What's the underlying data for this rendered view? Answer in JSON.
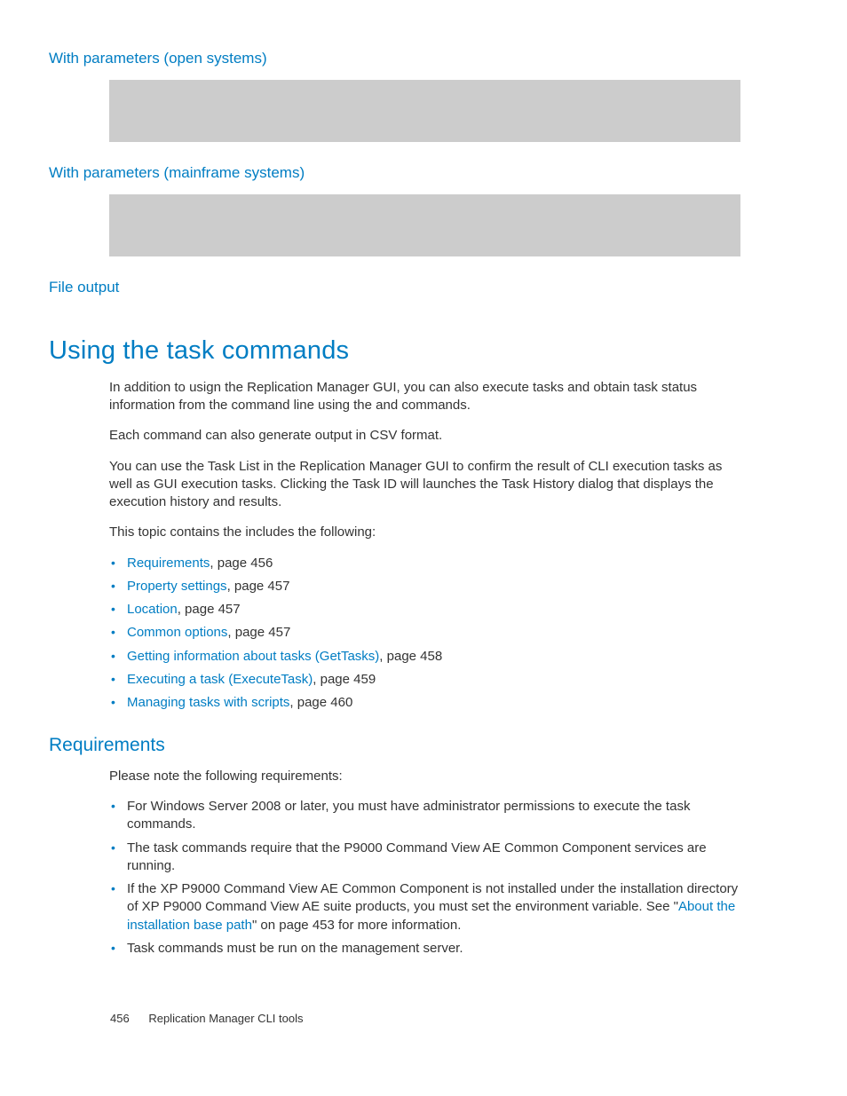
{
  "headings": {
    "open_systems": "With parameters (open systems)",
    "mainframe_systems": "With parameters (mainframe systems)",
    "file_output": "File output",
    "using_task_commands": "Using the task commands",
    "requirements": "Requirements"
  },
  "paragraphs": {
    "intro_pre": "In addition to usign the Replication Manager GUI, you can also execute tasks and obtain task status information from the command line using the ",
    "intro_mid": " and ",
    "intro_post": " commands.",
    "csv": "Each command can also generate output in CSV format.",
    "tasklist": "You can use the Task List in the Replication Manager GUI to confirm the result of CLI execution tasks as well as GUI execution tasks. Clicking the Task ID will launches the Task History dialog that displays the execution history and results.",
    "contains": "This topic contains the includes the following:",
    "req_intro": "Please note the following requirements:"
  },
  "toc": [
    {
      "label": "Requirements",
      "page": ", page 456"
    },
    {
      "label": "Property settings",
      "page": ", page 457"
    },
    {
      "label": "Location",
      "page": ", page 457"
    },
    {
      "label": "Common options",
      "page": ", page 457"
    },
    {
      "label": "Getting information about tasks (GetTasks)",
      "page": ", page 458"
    },
    {
      "label": "Executing a task (ExecuteTask)",
      "page": ", page 459"
    },
    {
      "label": "Managing tasks with scripts",
      "page": ", page 460"
    }
  ],
  "requirements_list": {
    "r0": "For Windows Server 2008 or later, you must have administrator permissions to execute the task commands.",
    "r1": "The task commands require that the P9000 Command View AE Common Component services are running.",
    "r2_pre": "If the XP P9000 Command View AE Common Component is not installed under the installation directory of XP P9000 Command View AE suite products, you must set the",
    "r2_mid1": " environment variable. See \"",
    "r2_link": "About the installation base path",
    "r2_mid2": "\" on page 453 for more information.",
    "r3": "Task commands must be run on the management server."
  },
  "footer": {
    "page_number": "456",
    "label": "Replication Manager CLI tools"
  }
}
